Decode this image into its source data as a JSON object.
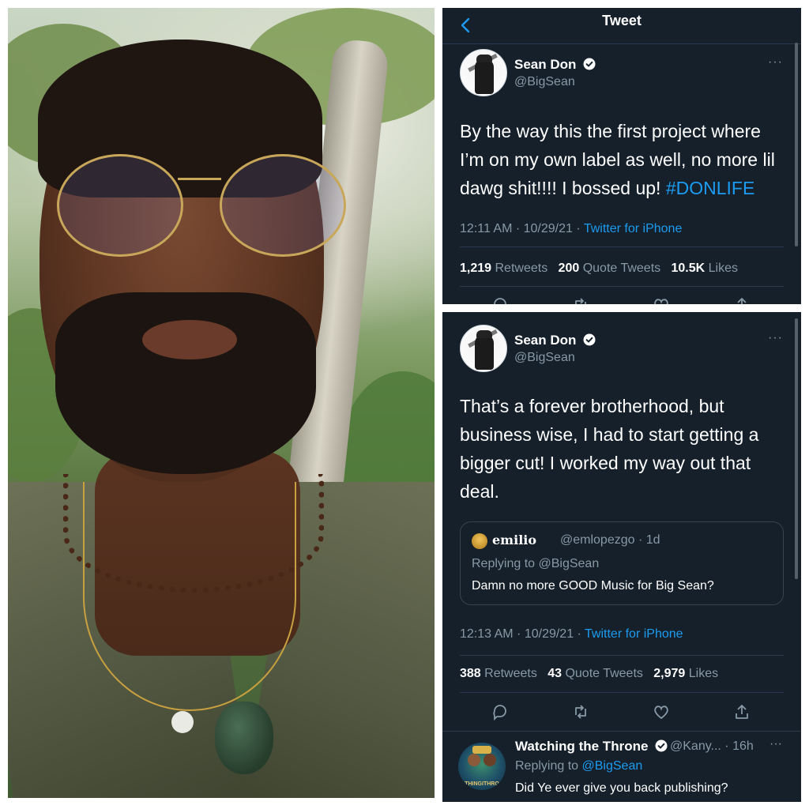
{
  "photo": {
    "alt_subject": "selfie"
  },
  "top_tweet": {
    "header_title": "Tweet",
    "author_name": "Sean Don",
    "author_handle": "@BigSean",
    "text_main": "By the way this the first project where I’m on my own label as well, no more lil dawg shit!!!! I bossed up! ",
    "hashtag": "#DONLIFE",
    "time_date": "12:11 AM · 10/29/21 · ",
    "source": "Twitter for iPhone",
    "retweets_count": "1,219",
    "retweets_label": "Retweets",
    "quotes_count": "200",
    "quotes_label": "Quote Tweets",
    "likes_count": "10.5K",
    "likes_label": "Likes",
    "more": "···"
  },
  "bottom_tweet": {
    "author_name": "Sean Don",
    "author_handle": "@BigSean",
    "text": "That’s a forever brotherhood, but business wise, I had to start getting a bigger cut! I worked my way out that deal.",
    "quote": {
      "name": "emilio",
      "handle_time": "@emlopezgo · 1d",
      "replying_to": "Replying to @BigSean",
      "text": "Damn no more GOOD Music for Big Sean?"
    },
    "time_date": "12:13 AM · 10/29/21 · ",
    "source": "Twitter for iPhone",
    "retweets_count": "388",
    "retweets_label": "Retweets",
    "quotes_count": "43",
    "quotes_label": "Quote Tweets",
    "likes_count": "2,979",
    "likes_label": "Likes",
    "more": "···"
  },
  "reply": {
    "name": "Watching the Throne",
    "handle_time": "@Kany... · 16h",
    "replying_prefix": "Replying to ",
    "replying_mention": "@BigSean",
    "text": "Did Ye ever give you back publishing?",
    "avatar_caption": "THINGITHRO",
    "more": "···"
  },
  "icons": [
    "back-arrow-icon",
    "verified-badge-icon",
    "more-icon",
    "reply-icon",
    "retweet-icon",
    "like-icon",
    "share-icon"
  ],
  "colors": {
    "background": "#15202b",
    "accent": "#1d9bf0",
    "muted": "#8899a6",
    "text": "#ffffff"
  }
}
